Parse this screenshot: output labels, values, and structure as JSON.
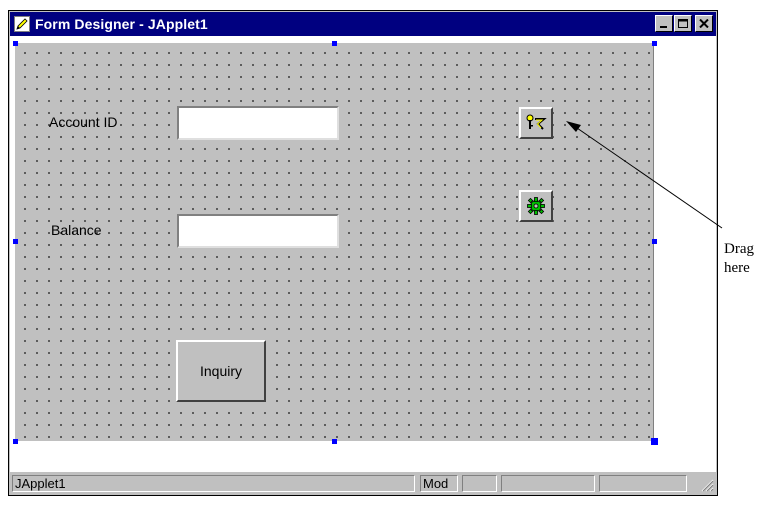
{
  "window": {
    "title": "Form Designer - JApplet1",
    "minimize_label": "_",
    "maximize_label": "□",
    "close_label": "✕",
    "icon": "pencil-icon"
  },
  "form": {
    "account_label": "Account ID",
    "account_value": "",
    "balance_label": "Balance",
    "balance_value": "",
    "inquiry_button": "Inquiry",
    "bean1_icon": "key-bean-icon",
    "bean2_icon": "gear-bean-icon"
  },
  "statusbar": {
    "name": "JApplet1",
    "mode": "Mod",
    "cell3": "",
    "cell4": "",
    "cell5": ""
  },
  "annotation": {
    "line1": "Drag",
    "line2": "here"
  },
  "colors": {
    "titlebar": "#000080",
    "design_surface": "#c0c0c0",
    "selection_handle": "#0000ff"
  }
}
